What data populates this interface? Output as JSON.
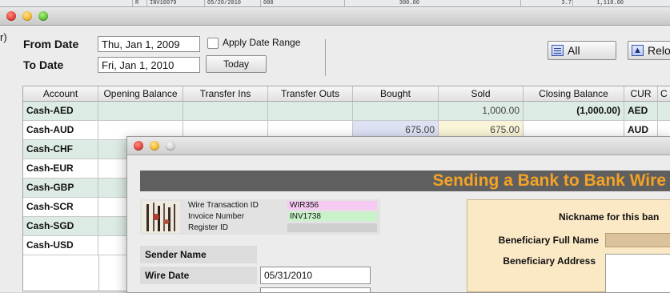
{
  "background_row": {
    "cells": [
      "R",
      "INV10079",
      "05/20/2010",
      "000",
      "300.00",
      "3.7",
      "1,110.00"
    ]
  },
  "back_window": {
    "partial_left_glyph": "r)",
    "from_date_label": "From Date",
    "from_date_value": "Thu, Jan 1, 2009",
    "to_date_label": "To Date",
    "to_date_value": "Fri, Jan 1, 2010",
    "apply_range_label": "Apply Date Range",
    "today_label": "Today",
    "all_label": "All",
    "reload_label": "Relo",
    "table": {
      "columns": [
        "Account",
        "Opening Balance",
        "Transfer Ins",
        "Transfer Outs",
        "Bought",
        "Sold",
        "Closing Balance",
        "CUR",
        "C"
      ],
      "rows": [
        {
          "account": "Cash-AED",
          "opening": "",
          "ins": "",
          "outs": "",
          "bought": "",
          "sold": "1,000.00",
          "closing": "(1,000.00)",
          "cur": "AED"
        },
        {
          "account": "Cash-AUD",
          "opening": "",
          "ins": "",
          "outs": "",
          "bought": "675.00",
          "sold": "675.00",
          "closing": "",
          "cur": "AUD"
        },
        {
          "account": "Cash-CHF",
          "opening": "",
          "ins": "",
          "outs": "",
          "bought": "",
          "sold": "",
          "closing": "",
          "cur": ""
        },
        {
          "account": "Cash-EUR",
          "opening": "",
          "ins": "",
          "outs": "",
          "bought": "",
          "sold": "",
          "closing": "",
          "cur": ""
        },
        {
          "account": "Cash-GBP",
          "opening": "",
          "ins": "",
          "outs": "",
          "bought": "",
          "sold": "",
          "closing": "",
          "cur": ""
        },
        {
          "account": "Cash-SCR",
          "opening": "",
          "ins": "",
          "outs": "",
          "bought": "",
          "sold": "",
          "closing": "",
          "cur": ""
        },
        {
          "account": "Cash-SGD",
          "opening": "",
          "ins": "",
          "outs": "",
          "bought": "",
          "sold": "",
          "closing": "",
          "cur": ""
        },
        {
          "account": "Cash-USD",
          "opening": "",
          "ins": "",
          "outs": "",
          "bought": "",
          "sold": "",
          "closing": "",
          "cur": ""
        }
      ]
    }
  },
  "front_window": {
    "banner_title": "Sending a Bank to Bank Wire",
    "wire_txn_label": "Wire Transaction ID",
    "wire_txn_value": "WIR356",
    "invoice_label": "Invoice Number",
    "invoice_value": "INV1738",
    "register_label": "Register ID",
    "register_value": "",
    "sender_name_label": "Sender Name",
    "wire_date_label": "Wire Date",
    "wire_date_value": "05/31/2010",
    "nickname_label": "Nickname for this ban",
    "beneficiary_name_label": "Beneficiary Full Name",
    "beneficiary_address_label": "Beneficiary Address"
  },
  "colors": {
    "banner_bg": "#5f5f5f",
    "banner_text": "#f4a325",
    "row_green": "#dcebe3",
    "bought_blue": "#dde2f5",
    "sold_yellow": "#faf5d8",
    "wire_id_pink": "#f6c9f2",
    "invoice_green": "#c8f2c8"
  }
}
